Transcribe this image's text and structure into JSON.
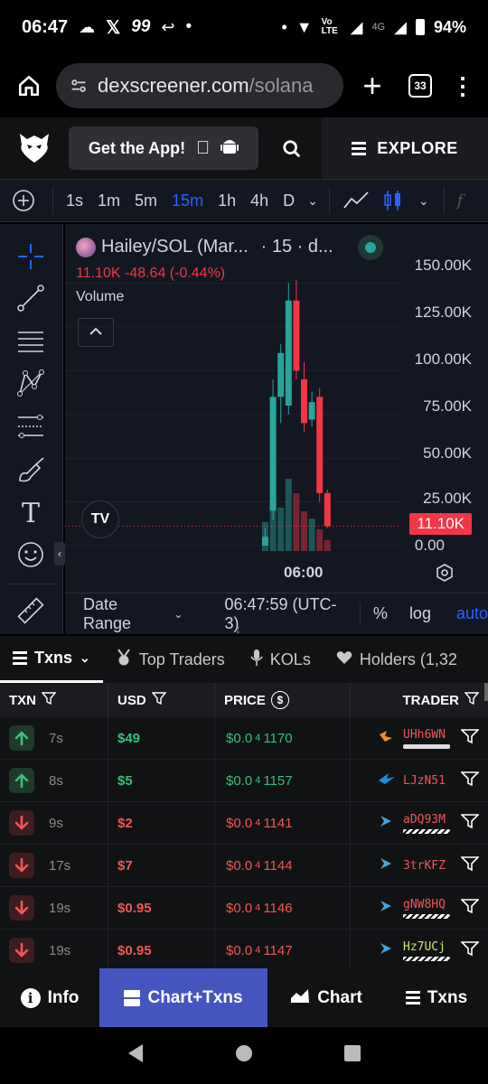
{
  "status": {
    "time": "06:47",
    "battery": "94%",
    "network_badge": "99",
    "lte_label": "Vo LTE",
    "fourg_label": "4G"
  },
  "browser": {
    "url_domain": "dexscreener.com",
    "url_path": "/solana",
    "tab_count": "33"
  },
  "header": {
    "get_app_label": "Get the App!",
    "explore_label": "EXPLORE"
  },
  "toolbar": {
    "timeframes": [
      "1s",
      "1m",
      "5m",
      "15m",
      "1h",
      "4h",
      "D"
    ],
    "active_timeframe": "15m",
    "fx_label": "f"
  },
  "chart": {
    "pair_title": "Hailey/SOL (Mar...",
    "interval_text": "· 15 · d...",
    "last_values": "11.10K  -48.64 (-0.44%)",
    "volume_label": "Volume",
    "yaxis": [
      "150.00K",
      "125.00K",
      "100.00K",
      "75.00K",
      "50.00K",
      "25.00K",
      "0.00"
    ],
    "price_tag": "11.10K",
    "xaxis_label": "06:00",
    "logo_text": "TV",
    "date_range_label": "Date Range",
    "clock": "06:47:59 (UTC-3)",
    "percent_label": "%",
    "log_label": "log",
    "auto_label": "auto",
    "accent_up": "#26a69a",
    "accent_down": "#f23645"
  },
  "chart_data": {
    "type": "bar",
    "ylim": [
      0,
      160000
    ],
    "candles": [
      {
        "o": 0,
        "h": 10000,
        "l": 0,
        "c": 5000
      },
      {
        "o": 20000,
        "h": 95000,
        "l": 15000,
        "c": 85000
      },
      {
        "o": 85000,
        "h": 115000,
        "l": 70000,
        "c": 110000
      },
      {
        "o": 80000,
        "h": 150000,
        "l": 75000,
        "c": 140000
      },
      {
        "o": 140000,
        "h": 152000,
        "l": 95000,
        "c": 100000
      },
      {
        "o": 95000,
        "h": 105000,
        "l": 65000,
        "c": 70000
      },
      {
        "o": 72000,
        "h": 88000,
        "l": 68000,
        "c": 82000
      },
      {
        "o": 85000,
        "h": 90000,
        "l": 25000,
        "c": 30000
      },
      {
        "o": 30000,
        "h": 32000,
        "l": 10000,
        "c": 11100
      }
    ],
    "volumes": [
      40,
      70,
      60,
      100,
      80,
      55,
      45,
      30,
      15
    ]
  },
  "txns": {
    "tabs": [
      {
        "label": "Txns"
      },
      {
        "label": "Top Traders"
      },
      {
        "label": "KOLs"
      },
      {
        "label": "Holders (1,32"
      }
    ],
    "columns": {
      "txn": "TXN",
      "usd": "USD",
      "price": "PRICE",
      "trader": "TRADER"
    },
    "rows": [
      {
        "side": "buy",
        "age": "7s",
        "usd": "$49",
        "price": "$0.0",
        "price_sub": "4",
        "price_tail": "1170",
        "trader": "UHh6WN",
        "trader_color": "#f25656",
        "bar": "solid"
      },
      {
        "side": "buy",
        "age": "8s",
        "usd": "$5",
        "price": "$0.0",
        "price_sub": "4",
        "price_tail": "1157",
        "trader": "LJzN51",
        "trader_color": "#f25656",
        "bar": "none"
      },
      {
        "side": "sell",
        "age": "9s",
        "usd": "$2",
        "price": "$0.0",
        "price_sub": "4",
        "price_tail": "1141",
        "trader": "aDQ93M",
        "trader_color": "#f25656",
        "bar": "striped"
      },
      {
        "side": "sell",
        "age": "17s",
        "usd": "$7",
        "price": "$0.0",
        "price_sub": "4",
        "price_tail": "1144",
        "trader": "3trKFZ",
        "trader_color": "#f25656",
        "bar": "none"
      },
      {
        "side": "sell",
        "age": "19s",
        "usd": "$0.95",
        "price": "$0.0",
        "price_sub": "4",
        "price_tail": "1146",
        "trader": "gNW8HQ",
        "trader_color": "#f25656",
        "bar": "striped"
      },
      {
        "side": "sell",
        "age": "19s",
        "usd": "$0.95",
        "price": "$0.0",
        "price_sub": "4",
        "price_tail": "1147",
        "trader": "Hz7UCj",
        "trader_color": "#c7e27a",
        "bar": "striped"
      }
    ]
  },
  "bottomnav": {
    "info": "Info",
    "chart_txns": "Chart+Txns",
    "chart": "Chart",
    "txns": "Txns"
  }
}
